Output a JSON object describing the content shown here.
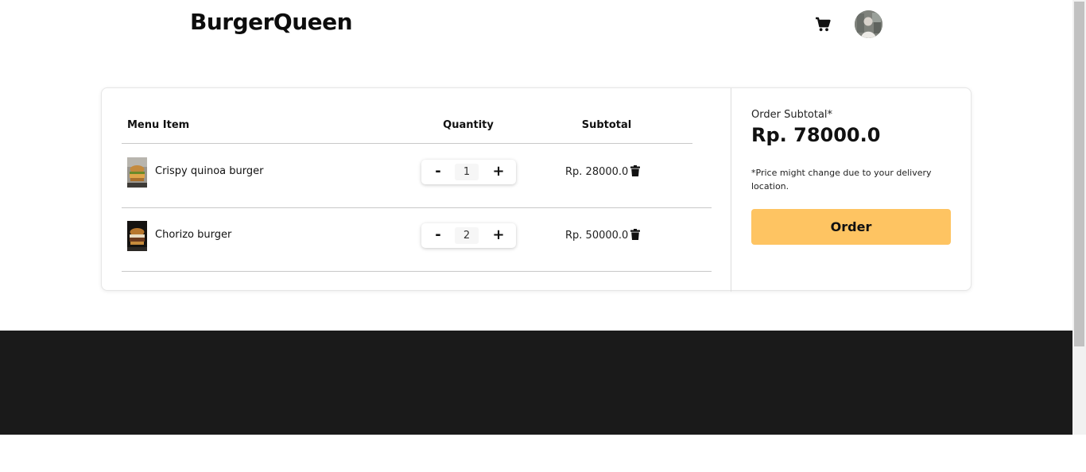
{
  "header": {
    "brand": "BurgerQueen",
    "cart_icon": "cart-icon",
    "avatar_icon": "user-avatar"
  },
  "cart": {
    "columns": {
      "item": "Menu Item",
      "quantity": "Quantity",
      "subtotal": "Subtotal"
    },
    "items": [
      {
        "name": "Crispy quinoa burger",
        "quantity": "1",
        "subtotal": "Rp. 28000.0"
      },
      {
        "name": "Chorizo burger",
        "quantity": "2",
        "subtotal": "Rp. 50000.0"
      }
    ],
    "stepper": {
      "minus": "-",
      "plus": "+"
    }
  },
  "summary": {
    "label": "Order Subtotal*",
    "total": "Rp. 78000.0",
    "note": "*Price might change due to your delivery location.",
    "order_button": "Order"
  },
  "colors": {
    "accent": "#fec462",
    "footer": "#1a1a1a"
  }
}
